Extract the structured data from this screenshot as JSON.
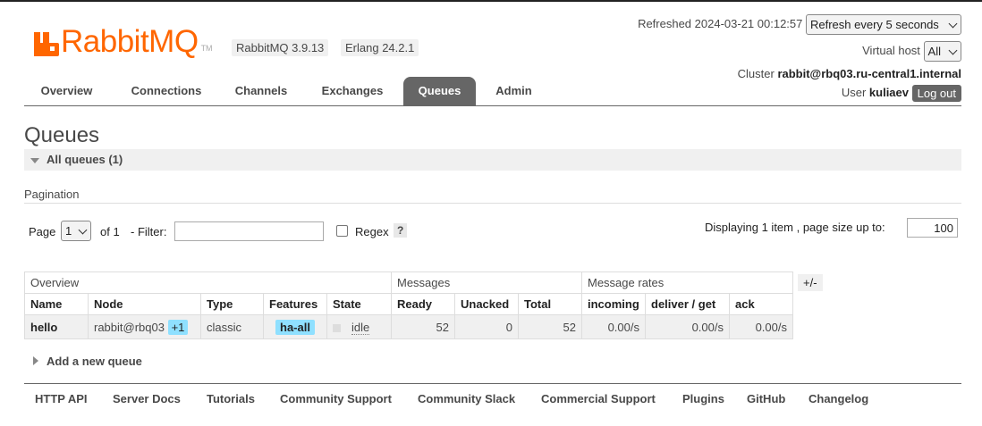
{
  "brand": {
    "logo_text": "RabbitMQ",
    "logo_tm": "TM",
    "version": "RabbitMQ 3.9.13",
    "erlang": "Erlang 24.2.1",
    "accent_color": "#ff6600"
  },
  "header": {
    "refreshed_label": "Refreshed 2024-03-21 00:12:57",
    "refresh_select": "Refresh every 5 seconds",
    "vhost_label": "Virtual host",
    "vhost_select": "All",
    "cluster_label": "Cluster",
    "cluster_name": "rabbit@rbq03.ru-central1.internal",
    "user_label": "User",
    "user_name": "kuliaev",
    "logout": "Log out"
  },
  "tabs": [
    {
      "label": "Overview",
      "active": false
    },
    {
      "label": "Connections",
      "active": false
    },
    {
      "label": "Channels",
      "active": false
    },
    {
      "label": "Exchanges",
      "active": false
    },
    {
      "label": "Queues",
      "active": true
    },
    {
      "label": "Admin",
      "active": false
    }
  ],
  "page": {
    "title": "Queues",
    "section": "All queues (1)",
    "pagination_label": "Pagination",
    "page_label": "Page",
    "page_select": "1",
    "of_label": "of 1",
    "filter_label": "- Filter:",
    "filter_value": "",
    "regex_label": "Regex",
    "regex_help": "?",
    "display_label": "Displaying 1 item , page size up to:",
    "page_size": "100",
    "plus_minus": "+/-",
    "add_queue": "Add a new queue"
  },
  "table": {
    "groups": [
      "Overview",
      "Messages",
      "Message rates"
    ],
    "columns": [
      "Name",
      "Node",
      "Type",
      "Features",
      "State",
      "Ready",
      "Unacked",
      "Total",
      "incoming",
      "deliver / get",
      "ack"
    ],
    "rows": [
      {
        "name": "hello",
        "node": "rabbit@rbq03",
        "node_extra": "+1",
        "type": "classic",
        "features": "ha-all",
        "state": "idle",
        "ready": "52",
        "unacked": "0",
        "total": "52",
        "incoming": "0.00/s",
        "deliver_get": "0.00/s",
        "ack": "0.00/s"
      }
    ]
  },
  "footer": [
    "HTTP API",
    "Server Docs",
    "Tutorials",
    "Community Support",
    "Community Slack",
    "Commercial Support",
    "Plugins",
    "GitHub",
    "Changelog"
  ]
}
